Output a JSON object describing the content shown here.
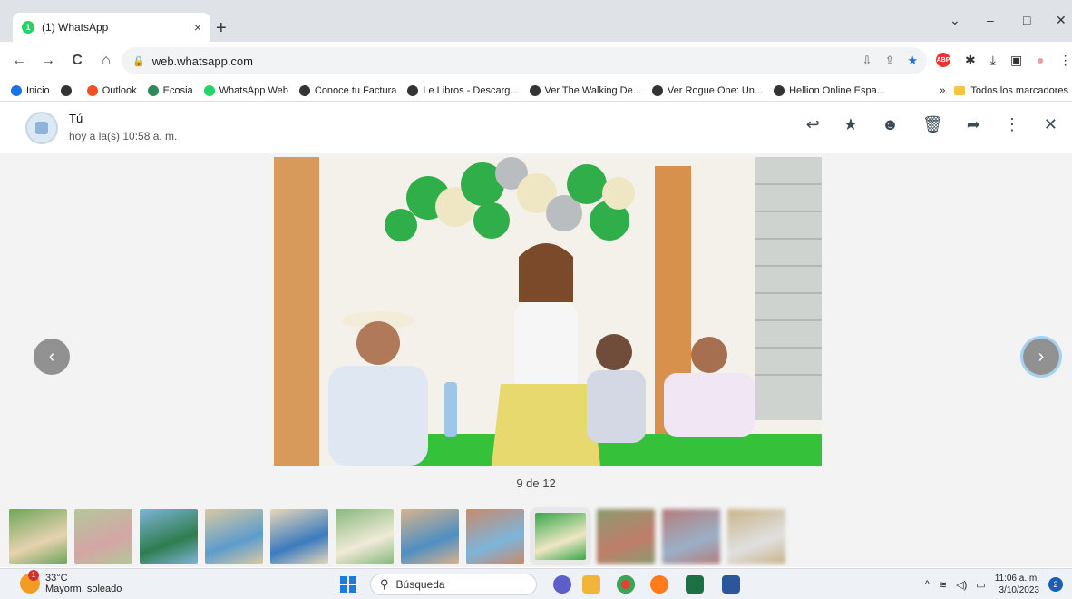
{
  "browser": {
    "tab_title": "(1) WhatsApp",
    "tab_badge": "1",
    "tab_close": "×",
    "new_tab": "+",
    "url": "web.whatsapp.com",
    "window_controls": {
      "dropdown": "⌄",
      "minimize": "–",
      "maximize": "□",
      "close": "✕"
    },
    "nav": {
      "back": "←",
      "forward": "→",
      "reload": "C",
      "home": "⌂"
    }
  },
  "bookmarks": {
    "items": [
      {
        "label": "Inicio",
        "color": "#1a73e8"
      },
      {
        "label": "",
        "color": "#333333"
      },
      {
        "label": "Outlook",
        "color": "#f25022"
      },
      {
        "label": "Ecosia",
        "color": "#2e8b57"
      },
      {
        "label": "WhatsApp Web",
        "color": "#25d366"
      },
      {
        "label": "Conoce tu Factura",
        "color": "#333333"
      },
      {
        "label": "Le Libros - Descarg...",
        "color": "#333333"
      },
      {
        "label": "Ver The Walking De...",
        "color": "#333333"
      },
      {
        "label": "Ver Rogue One: Un...",
        "color": "#333333"
      },
      {
        "label": "Hellion Online Espa...",
        "color": "#333333"
      }
    ],
    "overflow": "»",
    "all_bookmarks": "Todos los marcadores"
  },
  "viewer": {
    "sender": "Tú",
    "timestamp": "hoy a la(s) 10:58 a. m.",
    "counter": "9 de 12",
    "total_thumbnails": 12,
    "active_index": 9
  },
  "taskbar": {
    "temperature": "33°C",
    "weather": "Mayorm. soleado",
    "search_placeholder": "Búsqueda",
    "time": "11:06 a. m.",
    "date": "3/10/2023",
    "notifications": "2"
  }
}
